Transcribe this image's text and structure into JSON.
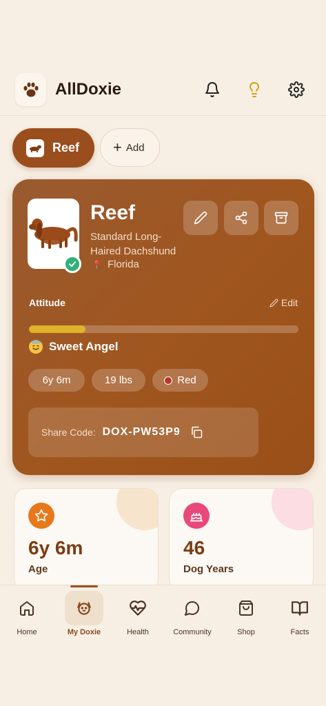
{
  "app": {
    "title": "AllDoxie"
  },
  "header": {
    "icons": [
      "bell-icon",
      "lightbulb-icon",
      "gear-icon"
    ]
  },
  "pets": [
    {
      "label": "Reef",
      "active": true
    },
    {
      "label": "Add",
      "icon": "plus-icon"
    }
  ],
  "profile": {
    "name": "Reef",
    "breed": "Standard Long-Haired Dachshund",
    "location": "Florida",
    "verified": true,
    "attitude_label": "Attitude",
    "edit_label": "Edit",
    "attitude_level": 0.21,
    "mood": "Sweet Angel",
    "chips": {
      "age": "6y 6m",
      "weight": "19 lbs",
      "color": "Red"
    },
    "share_key": "Share Code:",
    "share_code": "DOX-PW53P9"
  },
  "stats": [
    {
      "value": "6y 6m",
      "label": "Age",
      "icon": "star-icon",
      "accent": "#e8781c"
    },
    {
      "value": "46",
      "label": "Dog Years",
      "icon": "cake-icon",
      "accent": "#e8487a"
    }
  ],
  "nav": [
    {
      "label": "Home",
      "icon": "home-icon"
    },
    {
      "label": "My Doxie",
      "icon": "dog-icon",
      "active": true
    },
    {
      "label": "Health",
      "icon": "heart-pulse-icon"
    },
    {
      "label": "Community",
      "icon": "chat-icon"
    },
    {
      "label": "Shop",
      "icon": "bag-icon"
    },
    {
      "label": "Facts",
      "icon": "book-icon"
    }
  ],
  "colors": {
    "brand": "#9a4e1d",
    "background": "#f8efe4",
    "attitude_bar": "#e0b229",
    "verified": "#2fb27a"
  }
}
